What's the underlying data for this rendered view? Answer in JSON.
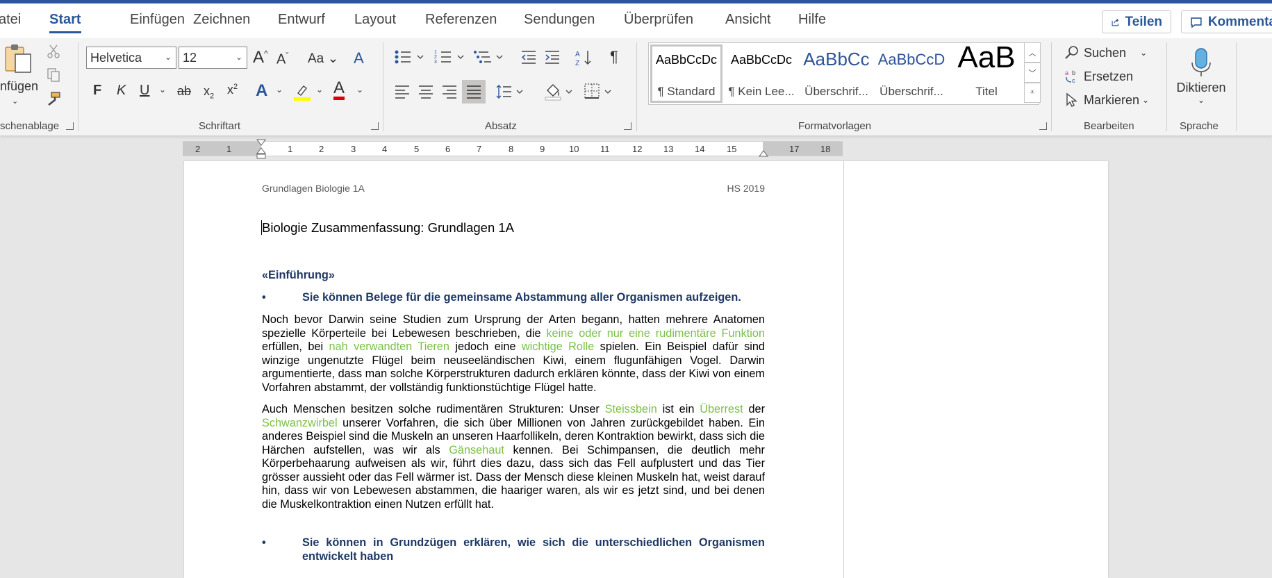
{
  "colors": {
    "accent": "#2b579a",
    "heading": "#1f3864",
    "highlight_text": "#7ac143"
  },
  "tabs": [
    "atei",
    "Start",
    "Einfügen",
    "Zeichnen",
    "Entwurf",
    "Layout",
    "Referenzen",
    "Sendungen",
    "Überprüfen",
    "Ansicht",
    "Hilfe"
  ],
  "active_tab": "Start",
  "top_buttons": {
    "share": "Teilen",
    "comments": "Kommenta"
  },
  "ribbon": {
    "clipboard": {
      "paste": "nfügen",
      "label": "schenablage"
    },
    "font": {
      "family": "Helvetica",
      "size": "12",
      "case_label": "Aa",
      "label": "Schriftart"
    },
    "paragraph": {
      "label": "Absatz"
    },
    "styles": {
      "label": "Formatvorlagen",
      "items": [
        {
          "sample": "AaBbCcDc",
          "name": "¶ Standard"
        },
        {
          "sample": "AaBbCcDc",
          "name": "¶ Kein Lee..."
        },
        {
          "sample": "AaBbCc",
          "name": "Überschrif..."
        },
        {
          "sample": "AaBbCcD",
          "name": "Überschrif..."
        },
        {
          "sample": "AaB",
          "name": "Titel"
        }
      ]
    },
    "editing": {
      "find": "Suchen",
      "replace": "Ersetzen",
      "select": "Markieren",
      "label": "Bearbeiten"
    },
    "voice": {
      "dictate": "Diktieren",
      "label": "Sprache"
    }
  },
  "ruler": [
    "2",
    "1",
    "1",
    "2",
    "3",
    "4",
    "5",
    "6",
    "7",
    "8",
    "9",
    "10",
    "11",
    "12",
    "13",
    "14",
    "15",
    "17",
    "18"
  ],
  "document": {
    "header_left": "Grundlagen Biologie 1A",
    "header_right": "HS 2019",
    "title": "Biologie Zusammenfassung: Grundlagen 1A",
    "section_heading": "«Einführung»",
    "bullet1": "Sie können Belege für die gemeinsame Abstammung aller Organismen aufzeigen.",
    "p1": {
      "t1": "Noch bevor Darwin seine Studien zum Ursprung der Arten begann, hatten mehrere Anatomen spezielle Körperteile bei Lebewesen beschrieben, die ",
      "g1": "keine oder nur eine rudimentäre Funktion",
      "t2": " erfüllen, bei ",
      "g2": "nah verwandten Tieren",
      "t3": " jedoch eine ",
      "g3": "wichtige Rolle",
      "t4": " spielen. Ein Beispiel dafür sind winzige ungenutzte Flügel beim neuseeländischen Kiwi, einem flugunfähigen Vogel. Darwin argumentierte, dass man solche Körperstrukturen dadurch erklären könnte, dass der Kiwi von einem Vorfahren abstammt, der vollständig funktionstüchtige Flügel hatte."
    },
    "p2": {
      "t1": "Auch Menschen besitzen solche rudimentären Strukturen: Unser ",
      "g1": "Steissbein",
      "t2": " ist ein ",
      "g2": "Überrest",
      "t3": " der ",
      "g3": "Schwanzwirbel",
      "t4": " unserer Vorfahren, die sich über Millionen von Jahren zurückgebildet haben. Ein anderes Beispiel sind die Muskeln an unseren Haarfollikeln, deren Kontraktion bewirkt, dass sich die Härchen aufstellen, was wir als ",
      "g4": "Gänsehaut",
      "t5": " kennen. Bei Schimpansen, die deutlich mehr Körperbehaarung aufweisen als wir, führt dies dazu, dass sich das Fell aufplustert und das Tier grösser aussieht oder das Fell wärmer ist. Dass der Mensch diese kleinen Muskeln hat, weist darauf hin, dass wir von Lebewesen abstammen, die haariger waren, als wir es jetzt sind, und bei denen die Muskelkontraktion einen Nutzen erfüllt hat."
    },
    "bullet2": "Sie können in Grundzügen erklären, wie sich die unterschiedlichen Organismen entwickelt haben"
  }
}
